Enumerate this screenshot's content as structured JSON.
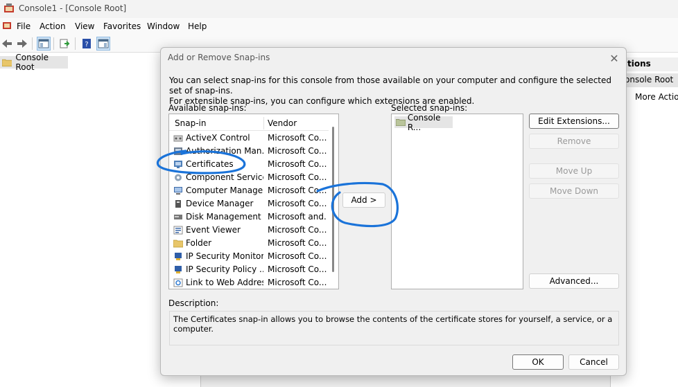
{
  "window": {
    "title": "Console1 - [Console Root]"
  },
  "menu": {
    "items": [
      "File",
      "Action",
      "View",
      "Favorites",
      "Window",
      "Help"
    ]
  },
  "toolbar": {
    "buttons": [
      "back-icon",
      "forward-icon",
      "show-hide-tree-icon",
      "export-list-icon",
      "help-icon",
      "show-hide-action-pane-icon"
    ]
  },
  "tree": {
    "root_label": "Console Root"
  },
  "actions_pane": {
    "header": "Actions",
    "header_visible": "tions",
    "sub_header": "Console Root",
    "sub_visible": "onsole Root",
    "more_actions": "More Actions"
  },
  "dialog": {
    "title": "Add or Remove Snap-ins",
    "intro_line1": "You can select snap-ins for this console from those available on your computer and configure the selected set of snap-ins.",
    "intro_line2": "For extensible snap-ins, you can configure which extensions are enabled.",
    "available_label": "Available snap-ins:",
    "selected_label": "Selected snap-ins:",
    "columns": {
      "snapin": "Snap-in",
      "vendor": "Vendor"
    },
    "snapins": [
      {
        "name": "ActiveX Control",
        "vendor": "Microsoft Co...",
        "icon": "activex-icon"
      },
      {
        "name": "Authorization Man...",
        "vendor": "Microsoft Co...",
        "icon": "authorization-icon"
      },
      {
        "name": "Certificates",
        "vendor": "Microsoft Co...",
        "icon": "certificates-icon"
      },
      {
        "name": "Component Services",
        "vendor": "Microsoft Co...",
        "icon": "component-services-icon"
      },
      {
        "name": "Computer Manage...",
        "vendor": "Microsoft Co...",
        "icon": "computer-management-icon"
      },
      {
        "name": "Device Manager",
        "vendor": "Microsoft Co...",
        "icon": "device-manager-icon"
      },
      {
        "name": "Disk Management",
        "vendor": "Microsoft and...",
        "icon": "disk-management-icon"
      },
      {
        "name": "Event Viewer",
        "vendor": "Microsoft Co...",
        "icon": "event-viewer-icon"
      },
      {
        "name": "Folder",
        "vendor": "Microsoft Co...",
        "icon": "folder-icon"
      },
      {
        "name": "IP Security Monitor",
        "vendor": "Microsoft Co...",
        "icon": "ip-security-icon"
      },
      {
        "name": "IP Security Policy ...",
        "vendor": "Microsoft Co...",
        "icon": "ip-security-policy-icon"
      },
      {
        "name": "Link to Web Address",
        "vendor": "Microsoft Co...",
        "icon": "link-icon"
      }
    ],
    "selected_items": [
      "Console R..."
    ],
    "add_button": "Add >",
    "buttons": {
      "edit_extensions": "Edit Extensions...",
      "remove": "Remove",
      "move_up": "Move Up",
      "move_down": "Move Down",
      "advanced": "Advanced..."
    },
    "description_label": "Description:",
    "description": "The Certificates snap-in allows you to browse the contents of the certificate stores for yourself, a service, or a computer.",
    "ok": "OK",
    "cancel": "Cancel"
  },
  "colors": {
    "annotation": "#1a73d9",
    "selection_bg": "#e5e5e5",
    "accent": "#0067c0"
  }
}
